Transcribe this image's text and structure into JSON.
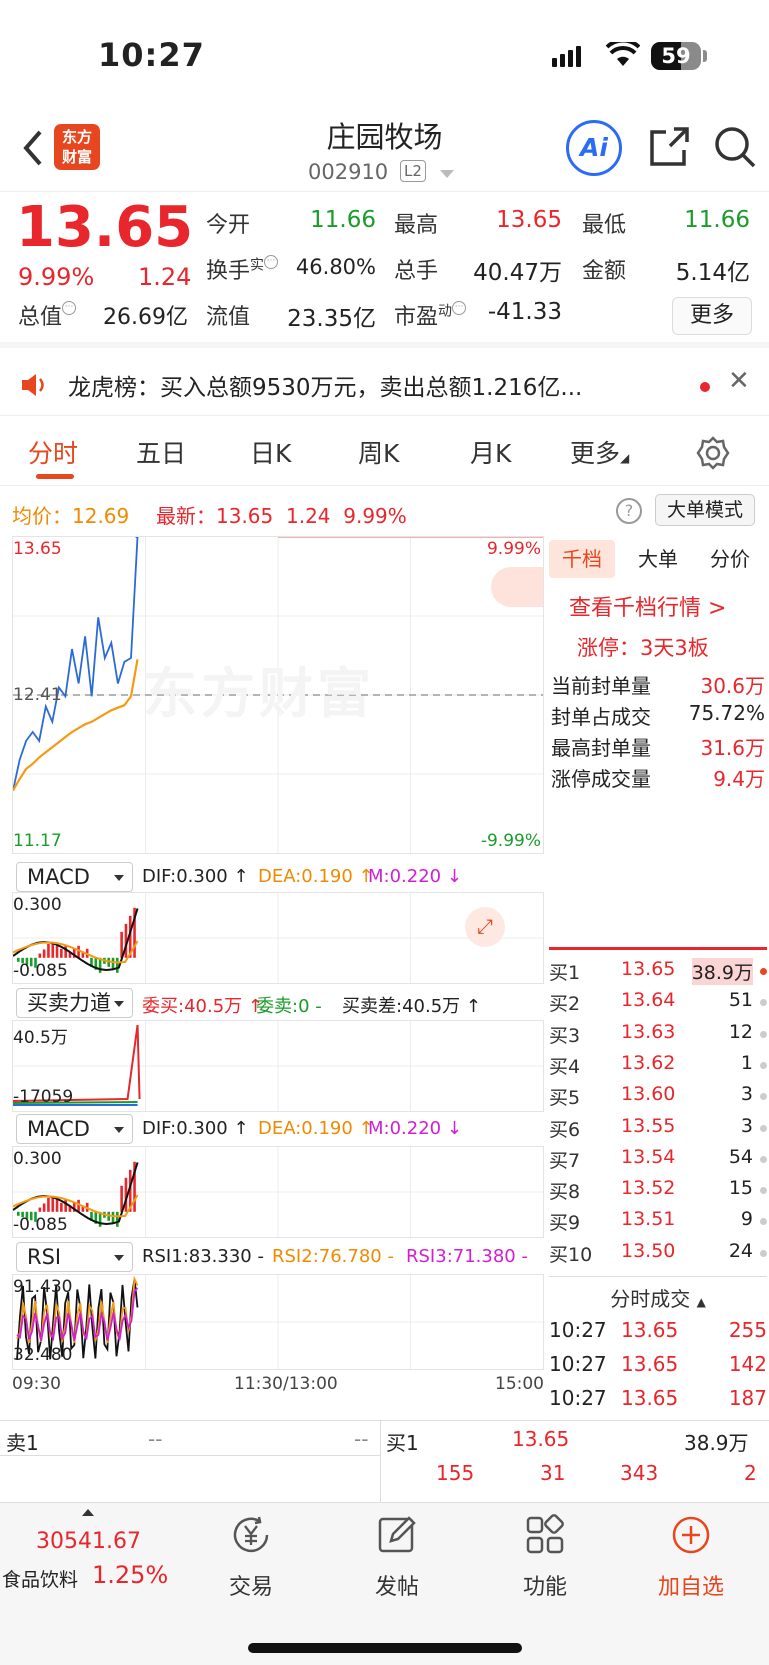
{
  "status_bar": {
    "time": "10:27",
    "battery": "59"
  },
  "header": {
    "back": "back",
    "logo": "东方财富",
    "name": "庄园牧场",
    "code": "002910",
    "level": "L2",
    "ai": "Ai"
  },
  "quote": {
    "price": "13.65",
    "pct": "9.99%",
    "chg": "1.24",
    "stats": [
      {
        "label": "今开",
        "value": "11.66",
        "color": "green"
      },
      {
        "label": "最高",
        "value": "13.65",
        "color": "red"
      },
      {
        "label": "最低",
        "value": "11.66",
        "color": "green"
      },
      {
        "label": "换手",
        "sup": "实",
        "value": "46.80%",
        "color": "black"
      },
      {
        "label": "总手",
        "value": "40.47万",
        "color": "black"
      },
      {
        "label": "金额",
        "value": "5.14亿",
        "color": "black"
      },
      {
        "label": "总值",
        "value": "26.69亿",
        "color": "black"
      },
      {
        "label": "流值",
        "value": "23.35亿",
        "color": "black"
      },
      {
        "label": "市盈",
        "sup": "动",
        "value": "-41.33",
        "color": "black"
      }
    ],
    "more": "更多"
  },
  "news": {
    "text": "龙虎榜：买入总额9530万元，卖出总额1.216亿..."
  },
  "tabs": [
    "分时",
    "五日",
    "日K",
    "周K",
    "月K",
    "更多"
  ],
  "chart_head": {
    "avg_label": "均价：",
    "avg": "12.69",
    "last_label": "最新：",
    "last": "13.65",
    "chg": "1.24",
    "pct": "9.99%",
    "mode": "大单模式"
  },
  "main_chart": {
    "top": "13.65",
    "top_pct": "9.99%",
    "mid": "12.41",
    "bottom": "11.17",
    "bottom_pct": "-9.99%",
    "watermark": "东方财富",
    "times": [
      "09:30",
      "11:30/13:00",
      "15:00"
    ]
  },
  "chart_data": {
    "type": "line",
    "title": "",
    "x": [
      "09:30",
      "09:33",
      "09:36",
      "09:39",
      "09:42",
      "09:45",
      "09:48",
      "09:51",
      "09:54",
      "09:57",
      "10:00",
      "10:03",
      "10:06",
      "10:09",
      "10:12",
      "10:15",
      "10:18",
      "10:21",
      "10:24",
      "10:27"
    ],
    "series": [
      {
        "name": "",
        "values": [
          11.66,
          11.9,
          12.05,
          12.0,
          12.15,
          12.2,
          12.3,
          12.35,
          12.5,
          12.65,
          12.6,
          12.75,
          12.5,
          12.9,
          12.8,
          12.7,
          12.6,
          12.55,
          12.8,
          13.65
        ]
      },
      {
        "name": "均价",
        "values": [
          11.66,
          11.75,
          11.83,
          11.87,
          11.92,
          11.96,
          12.0,
          12.04,
          12.08,
          12.12,
          12.15,
          12.18,
          12.2,
          12.23,
          12.26,
          12.29,
          12.31,
          12.33,
          12.4,
          12.69
        ]
      }
    ],
    "ylim": [
      11.17,
      13.65
    ]
  },
  "indicators": [
    {
      "name": "MACD",
      "parts": [
        {
          "t": "DIF:0.300 ↑",
          "c": "black"
        },
        {
          "t": "DEA:0.190 ↑",
          "c": "orange"
        },
        {
          "t": "M:0.220 ↓",
          "c": "magenta"
        }
      ],
      "top": "0.300",
      "bottom": "-0.085"
    },
    {
      "name": "买卖力道",
      "parts": [
        {
          "t": "委买:40.5万 ↑",
          "c": "red"
        },
        {
          "t": "委卖:0 -",
          "c": "green"
        },
        {
          "t": "买卖差:40.5万 ↑",
          "c": "black"
        }
      ],
      "top": "40.5万",
      "bottom": "-17059"
    },
    {
      "name": "MACD",
      "parts": [
        {
          "t": "DIF:0.300 ↑",
          "c": "black"
        },
        {
          "t": "DEA:0.190 ↑",
          "c": "orange"
        },
        {
          "t": "M:0.220 ↓",
          "c": "magenta"
        }
      ],
      "top": "0.300",
      "bottom": "-0.085"
    },
    {
      "name": "RSI",
      "parts": [
        {
          "t": "RSI1:83.330 -",
          "c": "black"
        },
        {
          "t": "RSI2:76.780 -",
          "c": "orange"
        },
        {
          "t": "RSI3:71.380 -",
          "c": "magenta"
        }
      ],
      "top": "91.430",
      "bottom": "32.480"
    }
  ],
  "right": {
    "tabs": [
      "千档",
      "大单",
      "分价"
    ],
    "link": "查看千档行情 >",
    "limit": "涨停：3天3板",
    "rows": [
      {
        "l": "当前封单量",
        "v": "30.6万"
      },
      {
        "l": "封单占成交",
        "v": "75.72%"
      },
      {
        "l": "最高封单量",
        "v": "31.6万"
      },
      {
        "l": "涨停成交量",
        "v": "9.4万"
      }
    ],
    "book": [
      {
        "l": "买1",
        "p": "13.65",
        "q": "38.9万"
      },
      {
        "l": "买2",
        "p": "13.64",
        "q": "51"
      },
      {
        "l": "买3",
        "p": "13.63",
        "q": "12"
      },
      {
        "l": "买4",
        "p": "13.62",
        "q": "1"
      },
      {
        "l": "买5",
        "p": "13.60",
        "q": "3"
      },
      {
        "l": "买6",
        "p": "13.55",
        "q": "3"
      },
      {
        "l": "买7",
        "p": "13.54",
        "q": "54"
      },
      {
        "l": "买8",
        "p": "13.52",
        "q": "15"
      },
      {
        "l": "买9",
        "p": "13.51",
        "q": "9"
      },
      {
        "l": "买10",
        "p": "13.50",
        "q": "24"
      }
    ],
    "ticks_title": "分时成交",
    "ticks": [
      {
        "t": "10:27",
        "p": "13.65",
        "v": "255"
      },
      {
        "t": "10:27",
        "p": "13.65",
        "v": "142"
      },
      {
        "t": "10:27",
        "p": "13.65",
        "v": "187"
      }
    ]
  },
  "orders": {
    "sell_label": "卖1",
    "sell_p": "--",
    "sell_q": "--",
    "buy_label": "买1",
    "buy_p": "13.65",
    "buy_q": "38.9万",
    "row2": [
      "155",
      "31",
      "343",
      "2"
    ]
  },
  "nav": {
    "index": "30541.67",
    "index_name": "食品饮料",
    "index_pct": "1.25%",
    "items": [
      "交易",
      "发帖",
      "功能",
      "加自选"
    ]
  }
}
